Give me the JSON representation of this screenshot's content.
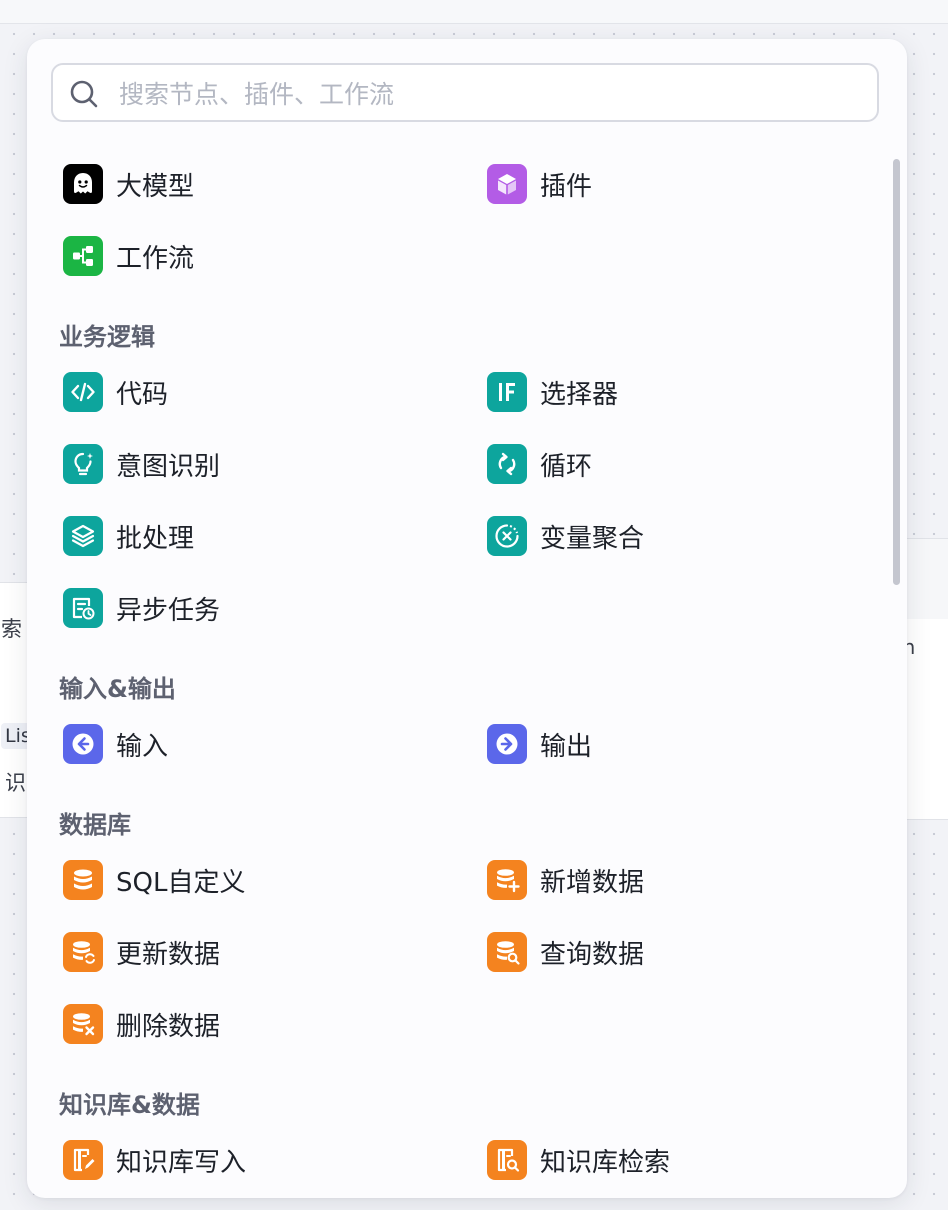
{
  "search": {
    "placeholder": "搜索节点、插件、工作流"
  },
  "top_items": [
    {
      "label": "大模型",
      "icon": "llm-ghost-icon",
      "color": "#000000"
    },
    {
      "label": "插件",
      "icon": "plugin-cube-icon",
      "color": "#b35ce6"
    },
    {
      "label": "工作流",
      "icon": "workflow-icon",
      "color": "#1bb544"
    }
  ],
  "sections": {
    "business_logic": {
      "title": "业务逻辑",
      "items": [
        {
          "label": "代码",
          "icon": "code-icon",
          "color": "#0da59d"
        },
        {
          "label": "选择器",
          "icon": "if-selector-icon",
          "color": "#0da59d"
        },
        {
          "label": "意图识别",
          "icon": "lightbulb-icon",
          "color": "#0da59d"
        },
        {
          "label": "循环",
          "icon": "loop-icon",
          "color": "#0da59d"
        },
        {
          "label": "批处理",
          "icon": "layers-icon",
          "color": "#0da59d"
        },
        {
          "label": "变量聚合",
          "icon": "variable-aggregate-icon",
          "color": "#0da59d"
        },
        {
          "label": "异步任务",
          "icon": "async-task-icon",
          "color": "#0da59d"
        }
      ]
    },
    "io": {
      "title": "输入&输出",
      "items": [
        {
          "label": "输入",
          "icon": "input-arrow-icon",
          "color": "#5b67ea"
        },
        {
          "label": "输出",
          "icon": "output-arrow-icon",
          "color": "#5b67ea"
        }
      ]
    },
    "database": {
      "title": "数据库",
      "items": [
        {
          "label": "SQL自定义",
          "icon": "database-icon",
          "color": "#f4831f"
        },
        {
          "label": "新增数据",
          "icon": "database-add-icon",
          "color": "#f4831f"
        },
        {
          "label": "更新数据",
          "icon": "database-update-icon",
          "color": "#f4831f"
        },
        {
          "label": "查询数据",
          "icon": "database-query-icon",
          "color": "#f4831f"
        },
        {
          "label": "删除数据",
          "icon": "database-delete-icon",
          "color": "#f4831f"
        }
      ]
    },
    "knowledge": {
      "title": "知识库&数据",
      "items": [
        {
          "label": "知识库写入",
          "icon": "knowledge-write-icon",
          "color": "#f4831f"
        },
        {
          "label": "知识库检索",
          "icon": "knowledge-search-icon",
          "color": "#f4831f"
        }
      ]
    }
  },
  "background": {
    "left_node_title": "索",
    "left_node_tag": "Lis",
    "left_node_text": "识",
    "right_node_text": "tion"
  }
}
